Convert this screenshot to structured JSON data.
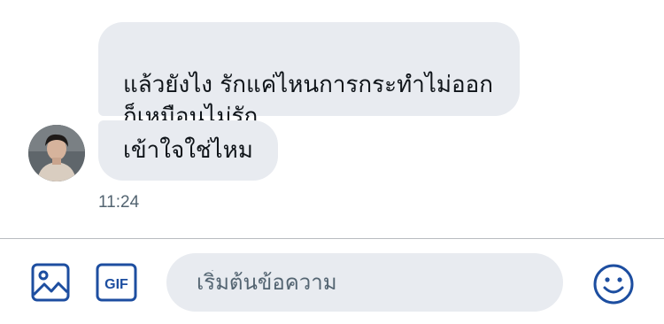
{
  "messages": [
    {
      "text": "แล้วยังไง รักแค่ไหนการกระทำไม่ออก\nก็เหมือนไม่รัก"
    },
    {
      "text": "เข้าใจใช่ไหม"
    }
  ],
  "timestamp": "11:24",
  "composer": {
    "placeholder": "เริ่มต้นข้อความ",
    "gif_label": "GIF"
  },
  "icons": {
    "image": "image-icon",
    "gif": "gif-icon",
    "emoji": "emoji-smile-icon",
    "avatar": "user-avatar"
  },
  "colors": {
    "accent": "#1d4ea0",
    "bubble": "#e8ebf0",
    "text": "#0f1419",
    "muted": "#536471"
  }
}
